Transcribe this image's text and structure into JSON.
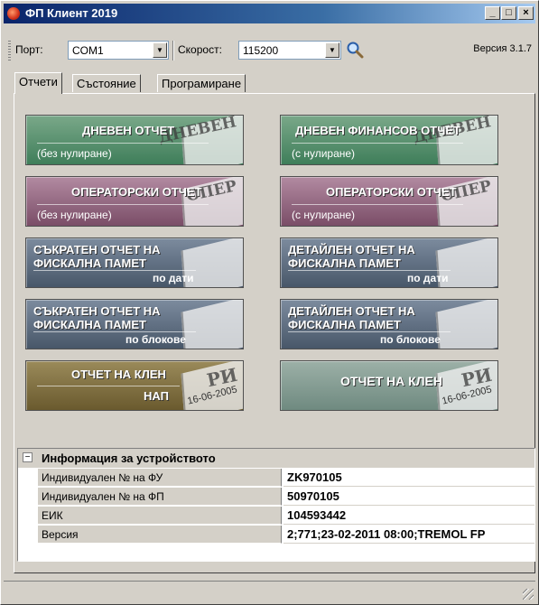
{
  "window": {
    "title": "ФП Клиент 2019",
    "minimize": "_",
    "maximize": "□",
    "close": "×"
  },
  "toolbar": {
    "port_label": "Порт:",
    "port_value": "COM1",
    "speed_label": "Скорост:",
    "speed_value": "115200",
    "search_icon": "magnifier-icon",
    "version": "Версия 3.1.7"
  },
  "tabs": [
    {
      "label": "Отчети",
      "active": true
    },
    {
      "label": "Състояние",
      "active": false
    },
    {
      "label": "Програмиране",
      "active": false
    }
  ],
  "reports": {
    "daily": {
      "title": "ДНЕВЕН ОТЧЕТ",
      "sub": "(без нулиране)",
      "stamp": "ДНЕВЕН",
      "color": "#5a9370"
    },
    "daily_fin": {
      "title": "ДНЕВЕН ФИНАНСОВ ОТЧЕТ",
      "sub": "(с нулиране)",
      "stamp": "ДНЕВЕН",
      "color": "#5a9370"
    },
    "oper_a": {
      "title": "ОПЕРАТОРСКИ ОТЧЕТ",
      "sub": "(без нулиране)",
      "stamp": "ОПЕР",
      "color": "#966a84"
    },
    "oper_b": {
      "title": "ОПЕРАТОРСКИ ОТЧЕТ",
      "sub": "(с нулиране)",
      "stamp": "ОПЕР",
      "color": "#966a84"
    },
    "short_date": {
      "title1": "СЪКРАТЕН ОТЧЕТ НА",
      "title2": "ФИСКАЛНА ПАМЕТ",
      "sub": "по дати",
      "color": "#5d6b7d"
    },
    "detail_date": {
      "title1": "ДЕТАЙЛЕН ОТЧЕТ НА",
      "title2": "ФИСКАЛНА ПАМЕТ",
      "sub": "по дати",
      "color": "#5d6b7d"
    },
    "short_block": {
      "title1": "СЪКРАТЕН ОТЧЕТ НА",
      "title2": "ФИСКАЛНА ПАМЕТ",
      "sub": "по блокове",
      "color": "#5d6b7d"
    },
    "detail_block": {
      "title1": "ДЕТАЙЛЕН ОТЧЕТ НА",
      "title2": "ФИСКАЛНА ПАМЕТ",
      "sub": "по блокове",
      "color": "#5d6b7d"
    },
    "klen_nap": {
      "title": "ОТЧЕТ НА КЛЕН",
      "sub": "НАП",
      "stamp": "РИ",
      "stamp2": "16-06-2005",
      "color": "#7f6f3f"
    },
    "klen": {
      "title": "ОТЧЕТ НА КЛЕН",
      "stamp": "РИ",
      "stamp2": "16-06-2005",
      "color": "#819d92"
    }
  },
  "device_info": {
    "title": "Информация за устройството",
    "expander": "⊟",
    "rows": [
      {
        "name": "Индивидуален № на ФУ",
        "value": "ZK970105"
      },
      {
        "name": "Индивидуален № на ФП",
        "value": "50970105"
      },
      {
        "name": "ЕИК",
        "value": "104593442"
      },
      {
        "name": "Версия",
        "value": "2;771;23-02-2011 08:00;TREMOL FP"
      }
    ]
  }
}
